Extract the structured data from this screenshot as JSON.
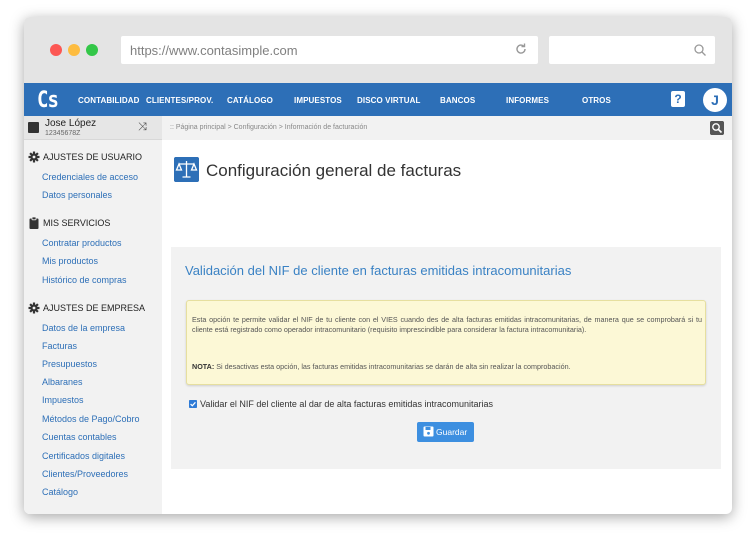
{
  "browser": {
    "url": "https://www.contasimple.com",
    "search_placeholder": ""
  },
  "app": {
    "logo": "Cs",
    "nav": [
      "CONTABILIDAD",
      "CLIENTES/PROV.",
      "CATÁLOGO",
      "IMPUESTOS",
      "DISCO VIRTUAL",
      "BANCOS",
      "INFORMES",
      "OTROS"
    ],
    "help": "?",
    "avatar_initial": "J",
    "brand_color": "#2d6fb7"
  },
  "user": {
    "name": "Jose López",
    "nif": "12345678Z"
  },
  "sidebar": {
    "sections": [
      {
        "title": "AJUSTES DE USUARIO",
        "icon": "gear-icon",
        "items": [
          "Credenciales de acceso",
          "Datos personales"
        ]
      },
      {
        "title": "MIS SERVICIOS",
        "icon": "clipboard-icon",
        "items": [
          "Contratar productos",
          "Mis productos",
          "Histórico de compras"
        ]
      },
      {
        "title": "AJUSTES DE EMPRESA",
        "icon": "gear-icon",
        "items": [
          "Datos de la empresa",
          "Facturas",
          "Presupuestos",
          "Albaranes",
          "Impuestos",
          "Métodos de Pago/Cobro",
          "Cuentas contables",
          "Certificados digitales",
          "Clientes/Proveedores",
          "Catálogo"
        ]
      }
    ]
  },
  "breadcrumb": ":: Página principal > Configuración > Información de facturación",
  "page": {
    "title": "Configuración general de facturas",
    "icon": "scales-icon"
  },
  "panel": {
    "title": "Validación del NIF de cliente en facturas emitidas intracomunitarias",
    "notice_text": "Esta opción te permite validar el NIF de tu cliente con el VIES cuando des de alta facturas emitidas intracomunitarias, de manera que se comprobará si tu cliente está registrado como operador intracomunitario (requisito imprescindible para considerar la factura intracomunitaria).",
    "note_label": "NOTA:",
    "note_text": " Si desactivas esta opción, las facturas emitidas intracomunitarias se darán de alta sin realizar la comprobación.",
    "checkbox_label": "Validar el NIF del cliente al dar de alta facturas emitidas intracomunitarias",
    "checkbox_checked": true,
    "save_label": "Guardar"
  }
}
